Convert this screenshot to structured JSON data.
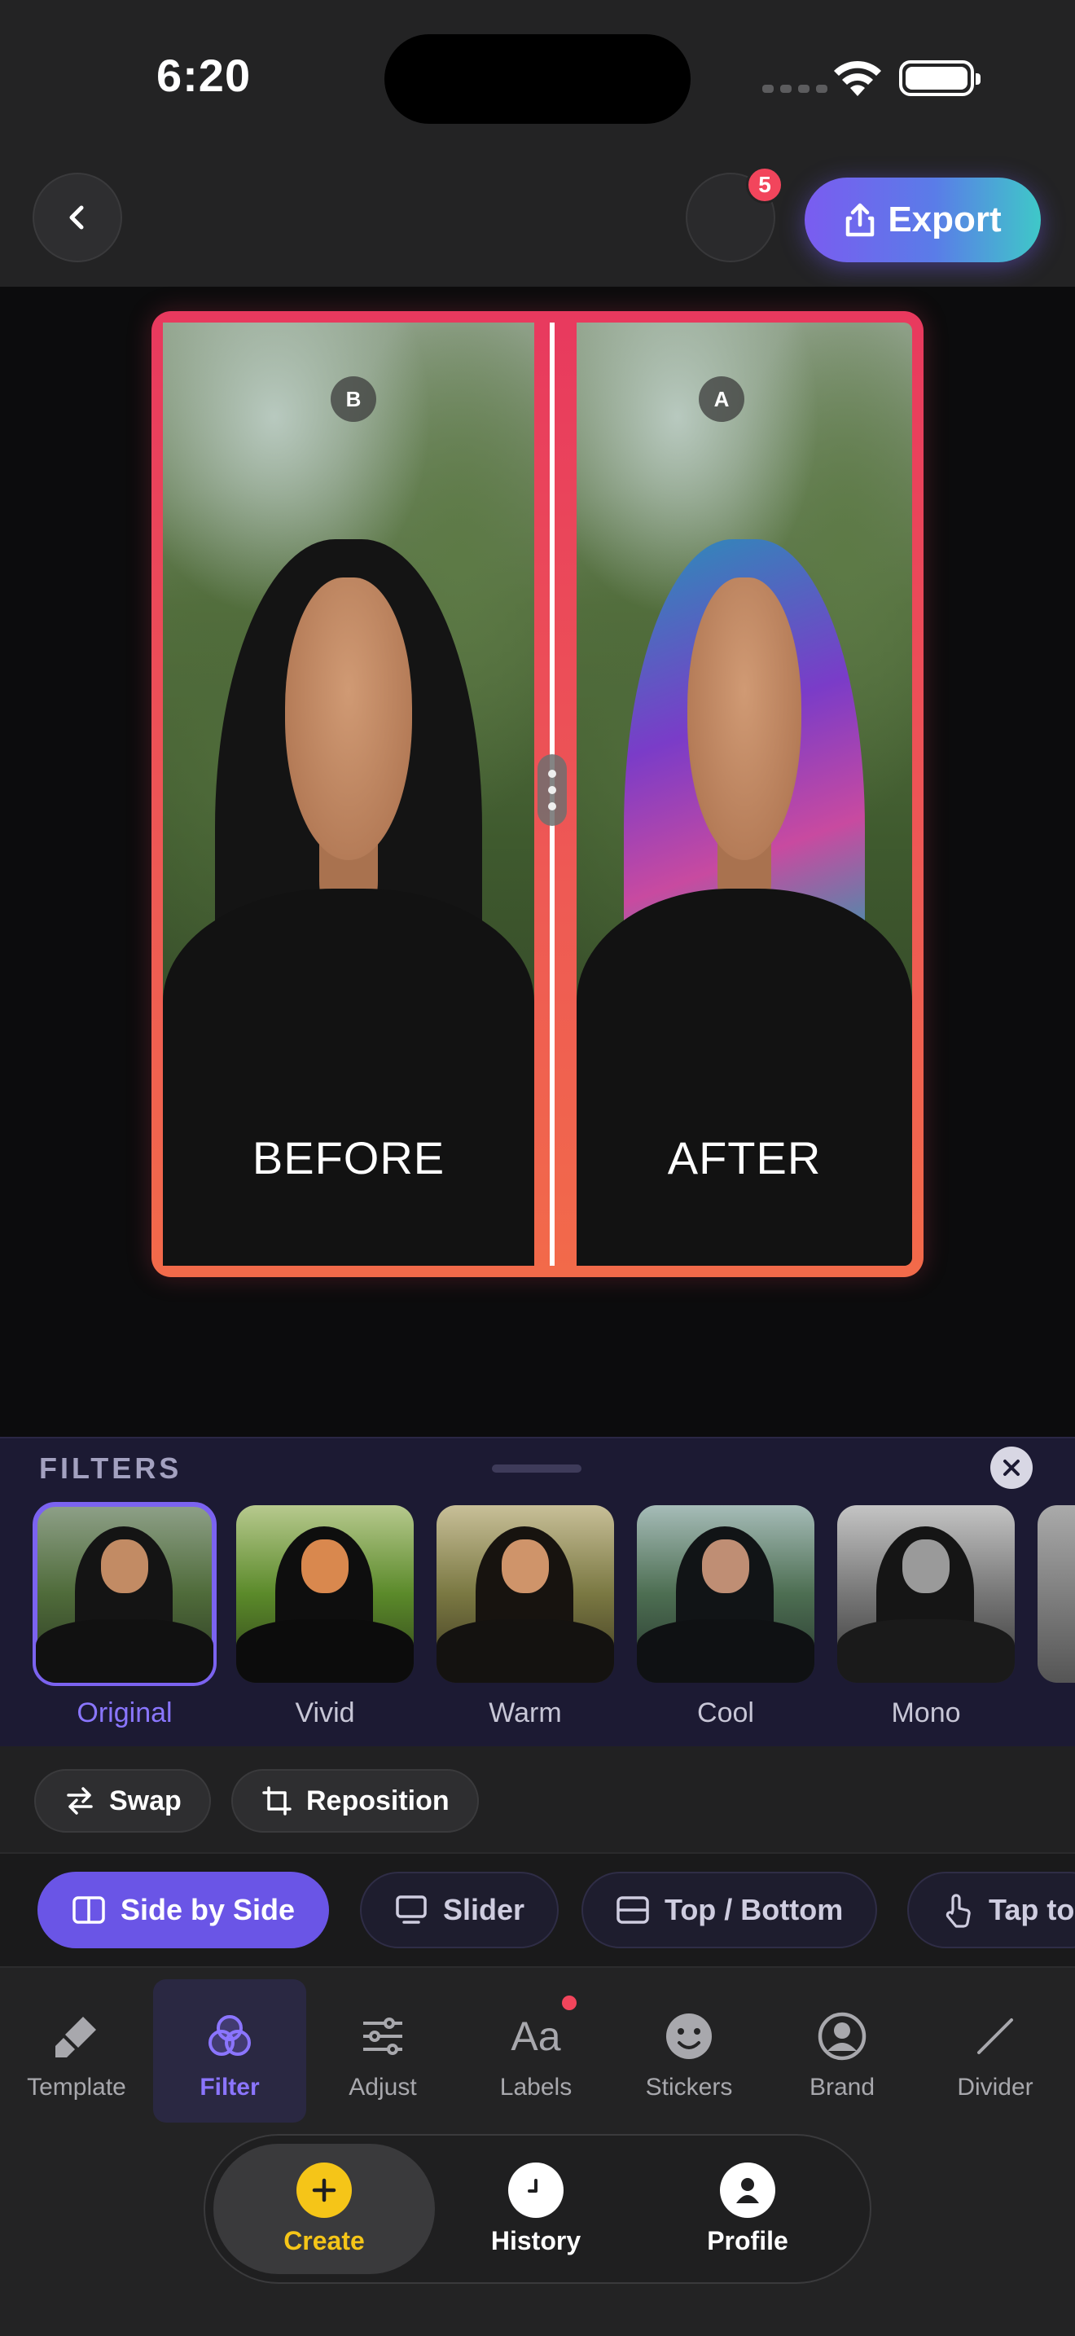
{
  "status": {
    "time": "6:20"
  },
  "header": {
    "export_label": "Export",
    "notification_count": "5"
  },
  "canvas": {
    "before_label": "BEFORE",
    "after_label": "AFTER",
    "left_badge": "B",
    "right_badge": "A"
  },
  "filters": {
    "title": "FILTERS",
    "items": [
      {
        "label": "Original",
        "selected": true
      },
      {
        "label": "Vivid",
        "selected": false
      },
      {
        "label": "Warm",
        "selected": false
      },
      {
        "label": "Cool",
        "selected": false
      },
      {
        "label": "Mono",
        "selected": false
      }
    ]
  },
  "actions": {
    "swap": "Swap",
    "reposition": "Reposition"
  },
  "layouts": {
    "items": [
      {
        "label": "Side by Side",
        "active": true
      },
      {
        "label": "Slider",
        "active": false
      },
      {
        "label": "Top / Bottom",
        "active": false
      },
      {
        "label": "Tap to",
        "active": false
      }
    ]
  },
  "tools": {
    "items": [
      {
        "label": "Template",
        "icon": "brush-icon"
      },
      {
        "label": "Filter",
        "icon": "filter-circles-icon",
        "active": true
      },
      {
        "label": "Adjust",
        "icon": "sliders-icon"
      },
      {
        "label": "Labels",
        "icon": "text-aa-icon",
        "has_dot": true
      },
      {
        "label": "Stickers",
        "icon": "smiley-icon"
      },
      {
        "label": "Brand",
        "icon": "user-circle-icon"
      },
      {
        "label": "Divider",
        "icon": "diagonal-line-icon"
      }
    ]
  },
  "tabbar": {
    "items": [
      {
        "label": "Create",
        "icon": "plus-icon",
        "active": true
      },
      {
        "label": "History",
        "icon": "clock-icon"
      },
      {
        "label": "Profile",
        "icon": "person-icon"
      }
    ]
  },
  "colors": {
    "accent": "#6a55e6",
    "export_gradient_start": "#7a5cf0",
    "export_gradient_end": "#3fc8c8",
    "frame": "#e8395e",
    "create_yellow": "#f5c518",
    "badge_red": "#f2455c"
  }
}
